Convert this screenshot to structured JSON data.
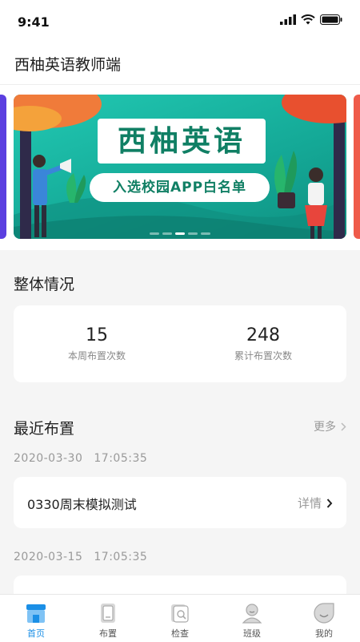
{
  "status_bar": {
    "time": "9:41"
  },
  "header": {
    "title": "西柚英语教师端"
  },
  "banner": {
    "title": "西柚英语",
    "subtitle": "入选校园APP白名单",
    "dot_count": 5,
    "active_dot": 3
  },
  "overview": {
    "title": "整体情况",
    "stats": [
      {
        "value": "15",
        "label": "本周布置次数"
      },
      {
        "value": "248",
        "label": "累计布置次数"
      }
    ]
  },
  "recent": {
    "title": "最近布置",
    "more_label": "更多",
    "records": [
      {
        "date": "2020-03-30",
        "time": "17:05:35",
        "name": "0330周末模拟测试",
        "detail_label": "详情"
      },
      {
        "date": "2020-03-15",
        "time": "17:05:35",
        "name": "",
        "detail_label": ""
      }
    ]
  },
  "tabs": [
    {
      "label": "首页",
      "icon": "home-icon",
      "active": true
    },
    {
      "label": "布置",
      "icon": "assign-icon",
      "active": false
    },
    {
      "label": "检查",
      "icon": "check-icon",
      "active": false
    },
    {
      "label": "班级",
      "icon": "class-icon",
      "active": false
    },
    {
      "label": "我的",
      "icon": "profile-icon",
      "active": false
    }
  ],
  "colors": {
    "accent": "#1b8fe6",
    "banner": "#14a896",
    "banner_text": "#107f64"
  }
}
